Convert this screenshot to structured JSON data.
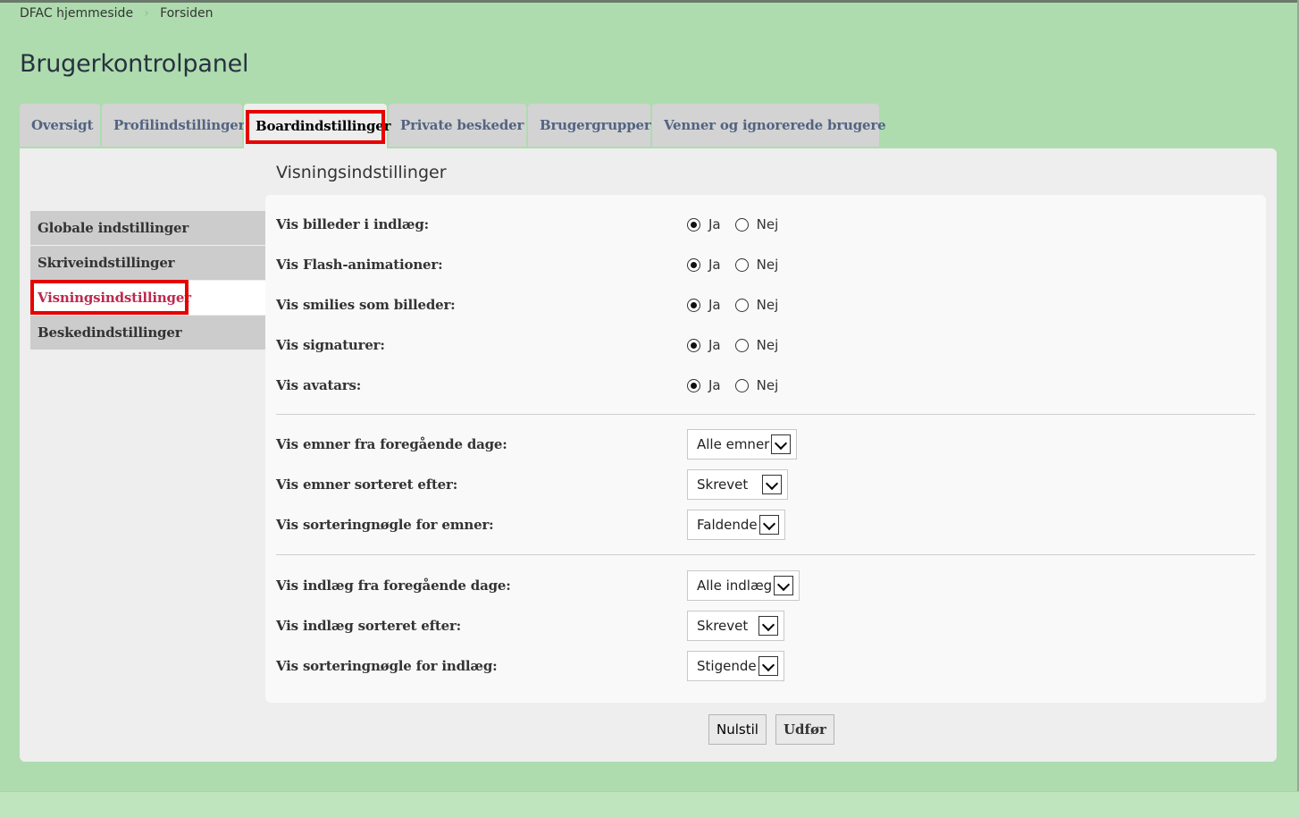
{
  "breadcrumbs": [
    "DFAC hjemmeside",
    "Forsiden"
  ],
  "page_title": "Brugerkontrolpanel",
  "tabs": [
    {
      "label": "Oversigt"
    },
    {
      "label": "Profilindstillinger"
    },
    {
      "label": "Boardindstillinger"
    },
    {
      "label": "Private beskeder"
    },
    {
      "label": "Brugergrupper"
    },
    {
      "label": "Venner og ignorerede brugere"
    }
  ],
  "section_title": "Visningsindstillinger",
  "menu": [
    {
      "label": "Globale indstillinger"
    },
    {
      "label": "Skriveindstillinger"
    },
    {
      "label": "Visningsindstillinger"
    },
    {
      "label": "Beskedindstillinger"
    }
  ],
  "radio_labels": {
    "yes": "Ja",
    "no": "Nej"
  },
  "radio_rows": [
    {
      "label": "Vis billeder i indlæg:",
      "selected": "Ja"
    },
    {
      "label": "Vis Flash-animationer:",
      "selected": "Ja"
    },
    {
      "label": "Vis smilies som billeder:",
      "selected": "Ja"
    },
    {
      "label": "Vis signaturer:",
      "selected": "Ja"
    },
    {
      "label": "Vis avatars:",
      "selected": "Ja"
    }
  ],
  "topic_rows": [
    {
      "label": "Vis emner fra foregående dage:",
      "value": "Alle emner"
    },
    {
      "label": "Vis emner sorteret efter:",
      "value": "Skrevet"
    },
    {
      "label": "Vis sorteringnøgle for emner:",
      "value": "Faldende"
    }
  ],
  "post_rows": [
    {
      "label": "Vis indlæg fra foregående dage:",
      "value": "Alle indlæg"
    },
    {
      "label": "Vis indlæg sorteret efter:",
      "value": "Skrevet"
    },
    {
      "label": "Vis sorteringnøgle for indlæg:",
      "value": "Stigende"
    }
  ],
  "buttons": {
    "reset": "Nulstil",
    "submit": "Udfør"
  },
  "highlight_color": "#e60000",
  "active_menu_color": "#bc2a4d"
}
